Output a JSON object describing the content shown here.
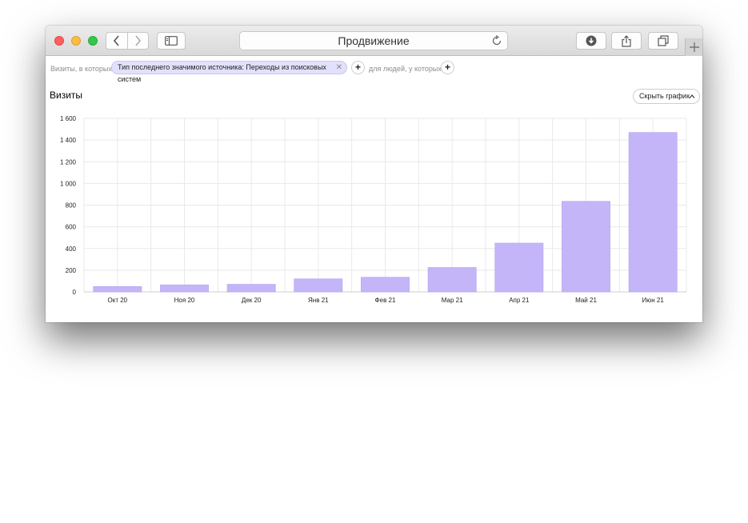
{
  "window": {
    "title": "Продвижение"
  },
  "toolbar": {
    "back_icon": "chevron-left-icon",
    "forward_icon": "chevron-right-icon",
    "sidebar_icon": "sidebar-icon",
    "download_icon": "download-icon",
    "share_icon": "share-icon",
    "tabs_icon": "tabs-overview-icon",
    "newtab_icon": "plus-icon",
    "reload_icon": "reload-icon"
  },
  "filters": {
    "prefix": "Визиты, в которых",
    "chip_label": "Тип последнего значимого источника: Переходы из поисковых систем",
    "add_label": "+",
    "people_label": "для людей, у которых",
    "add_people_label": "+"
  },
  "report": {
    "title": "Визиты",
    "hide_chart_label": "Скрыть график"
  },
  "colors": {
    "bar": "#c4b5f8",
    "bar_stroke": "#b3a3f0",
    "grid": "#e9e9e9"
  },
  "chart_data": {
    "type": "bar",
    "title": "Визиты",
    "categories": [
      "Окт 20",
      "Ноя 20",
      "Дек 20",
      "Янв 21",
      "Фев 21",
      "Мар 21",
      "Апр 21",
      "Май 21",
      "Июн 21"
    ],
    "values": [
      50,
      65,
      70,
      120,
      135,
      225,
      450,
      835,
      1470
    ],
    "ylim": [
      0,
      1600
    ],
    "yticks": [
      0,
      200,
      400,
      600,
      800,
      1000,
      1200,
      1400,
      1600
    ],
    "ytick_labels": [
      "0",
      "200",
      "400",
      "600",
      "800",
      "1 000",
      "1 200",
      "1 400",
      "1 600"
    ],
    "xlabel": "",
    "ylabel": "",
    "grid": true,
    "legend": "none"
  }
}
